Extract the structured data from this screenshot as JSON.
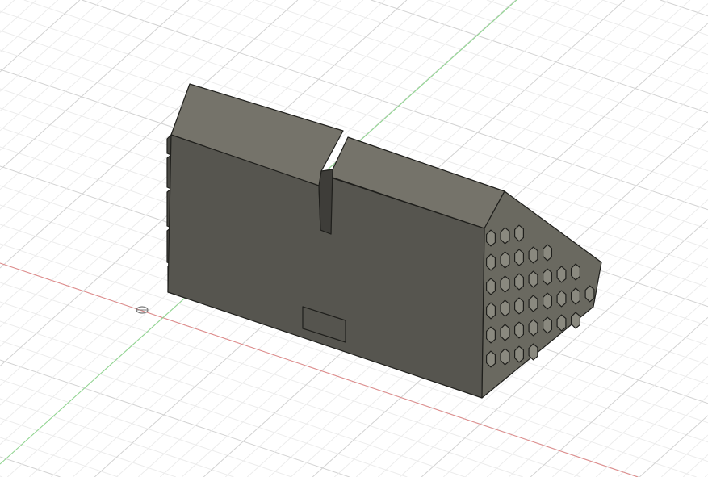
{
  "viewport": {
    "background": "#ffffff",
    "grid_major_color": "#d2d2d2",
    "grid_minor_color": "#ececec",
    "x_axis_color": "#e08a8a",
    "y_axis_color": "#8fd88f"
  },
  "model": {
    "front_color": "#56554f",
    "top_color": "#75736a",
    "side_color": "#6a6960",
    "hex_color": "#8a897f",
    "edge_color": "#1f1f1c"
  },
  "icons": [
    "origin-icon"
  ]
}
